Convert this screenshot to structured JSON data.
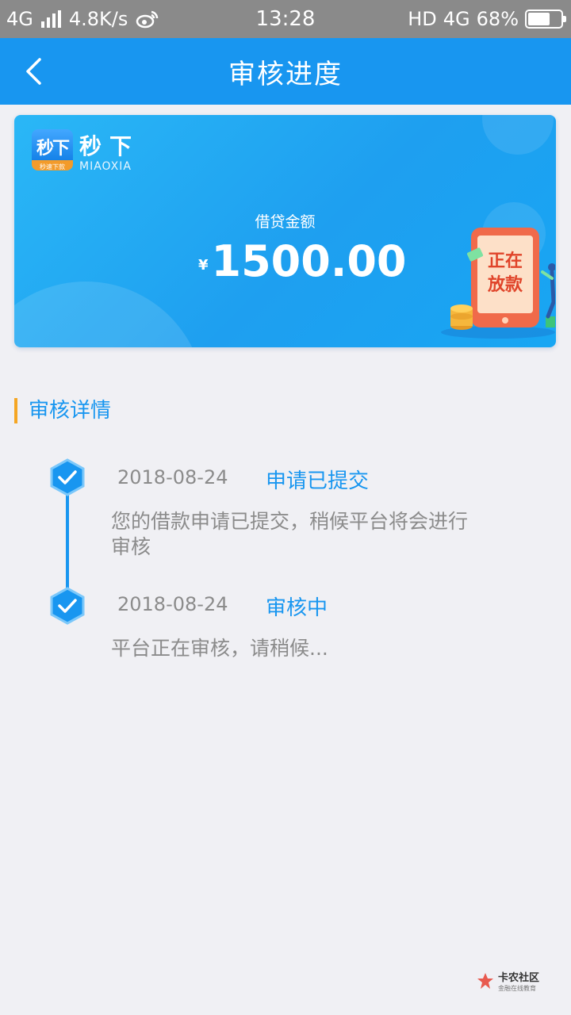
{
  "status_bar": {
    "network": "4G",
    "speed": "4.8K/s",
    "time": "13:28",
    "hd": "HD",
    "net_right": "4G",
    "battery": "68%",
    "battery_level": 0.68
  },
  "nav": {
    "title": "审核进度"
  },
  "card": {
    "brand_logo_text": "秒下",
    "brand_logo_sub": "秒速下款",
    "brand_name": "秒下",
    "brand_en": "MIAOXIA",
    "amount_label": "借贷金额",
    "currency": "¥",
    "amount": "1500.00",
    "badge_line1": "正在",
    "badge_line2": "放款"
  },
  "section": {
    "title": "审核详情"
  },
  "steps": [
    {
      "date": "2018-08-24",
      "status": "申请已提交",
      "desc_line1": "您的借款申请已提交，稍候平台将会进行",
      "desc_line2": "审核"
    },
    {
      "date": "2018-08-24",
      "status": "审核中",
      "desc_line1": "平台正在审核，请稍候..."
    }
  ],
  "watermark": {
    "title": "卡农社区",
    "sub": "金融在线教育"
  },
  "colors": {
    "primary": "#1896f0",
    "accent": "#f5a623",
    "text_gray": "#8b8b8b",
    "background": "#f0f0f4"
  }
}
